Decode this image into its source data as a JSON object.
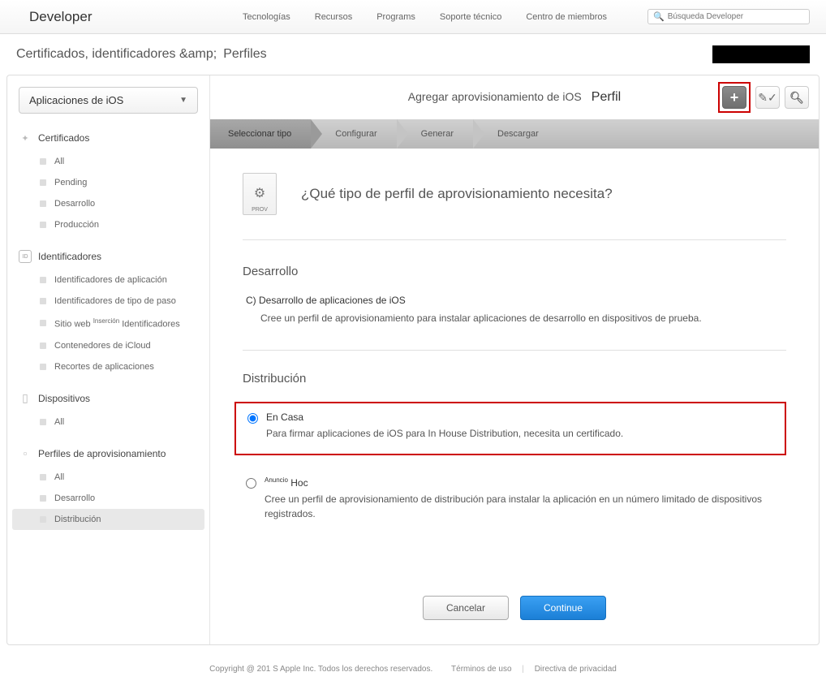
{
  "topnav": {
    "brand": "Developer",
    "links": [
      "Tecnologías",
      "Recursos",
      "Programs",
      "Soporte técnico",
      "Centro de miembros"
    ],
    "search_placeholder": "Búsqueda Developer"
  },
  "subheader": {
    "title1": "Certificados, identificadores &amp;",
    "title2": "Perfiles"
  },
  "sidebar": {
    "dropdown": "Aplicaciones de iOS",
    "sections": [
      {
        "title": "Certificados",
        "items": [
          "All",
          "Pending",
          "Desarrollo",
          "Producción"
        ]
      },
      {
        "title": "Identificadores",
        "items": [
          "Identificadores de aplicación",
          "Identificadores de tipo de paso",
          "Sitio web",
          "Contenedores de iCloud",
          "Recortes de aplicaciones"
        ],
        "inline_sup": "Inserción",
        "inline_after": "Identificadores"
      },
      {
        "title": "Dispositivos",
        "items": [
          "All"
        ]
      },
      {
        "title": "Perfiles de aprovisionamiento",
        "items": [
          "All",
          "Desarrollo",
          "Distribución"
        ],
        "selected": 2
      }
    ]
  },
  "content": {
    "header_title": "Agregar aprovisionamiento de iOS",
    "header_title2": "Perfil",
    "steps": [
      "Seleccionar tipo",
      "Configurar",
      "Generar",
      "Descargar"
    ],
    "prov_label": "PROV",
    "hero_question": "¿Qué tipo de perfil de aprovisionamiento necesita?",
    "dev_heading": "Desarrollo",
    "dev_option_title": "C) Desarrollo de aplicaciones de iOS",
    "dev_option_desc": "Cree un perfil de aprovisionamiento para instalar aplicaciones de desarrollo en dispositivos de prueba.",
    "dist_heading": "Distribución",
    "dist_opt1_prefix": "En",
    "dist_opt1_rest": "Casa",
    "dist_opt1_desc": "Para firmar aplicaciones de iOS para In House Distribution, necesita un certificado.",
    "dist_opt2_sup": "Anuncio",
    "dist_opt2_rest": "Hoc",
    "dist_opt2_desc": "Cree un perfil de aprovisionamiento de distribución para instalar la aplicación en un número limitado de dispositivos registrados.",
    "cancel": "Cancelar",
    "continue": "Continue"
  },
  "footer": {
    "copyright": "Copyright @ 201 S Apple Inc. Todos los derechos reservados.",
    "terms": "Términos de uso",
    "privacy": "Directiva de privacidad"
  }
}
